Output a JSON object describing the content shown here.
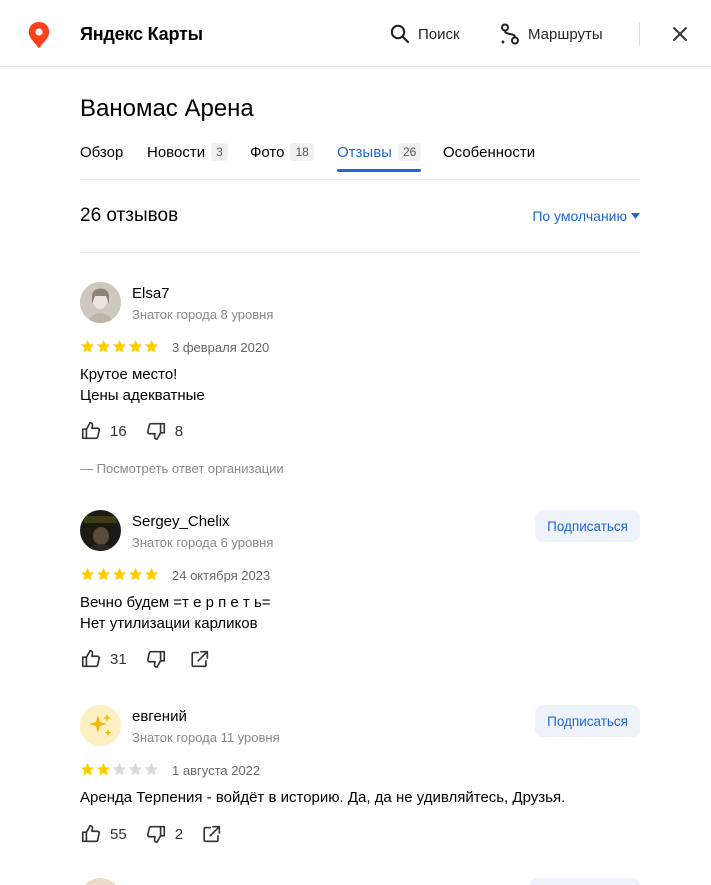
{
  "header": {
    "app_title": "Яндекс Карты",
    "search_label": "Поиск",
    "routes_label": "Маршруты",
    "brand_color": "#fc3f1d"
  },
  "place": {
    "title": "Ваномас Арена"
  },
  "tabs": [
    {
      "label": "Обзор",
      "count": ""
    },
    {
      "label": "Новости",
      "count": "3"
    },
    {
      "label": "Фото",
      "count": "18"
    },
    {
      "label": "Отзывы",
      "count": "26",
      "active": true
    },
    {
      "label": "Особенности",
      "count": ""
    }
  ],
  "reviews_header": {
    "count_label": "26 отзывов",
    "sort_label": "По умолчанию"
  },
  "reviews": [
    {
      "author": "Elsa7",
      "level": "Знаток города 8 уровня",
      "rating": 5,
      "date": "3 февраля 2020",
      "text": "Крутое место!\nЦены адекватные",
      "likes": "16",
      "dislikes": "8",
      "org_answer_label": "— Посмотреть ответ организации"
    },
    {
      "author": "Sergey_Chelix",
      "level": "Знаток города 6 уровня",
      "subscribe_label": "Подписаться",
      "rating": 5,
      "date": "24 октября 2023",
      "text": "Вечно будем =т е р п е т ь=\nНет утилизации карликов",
      "likes": "31",
      "dislikes": ""
    },
    {
      "author": "евгений",
      "level": "Знаток города 11 уровня",
      "subscribe_label": "Подписаться",
      "rating": 2,
      "date": "1 августа 2022",
      "text": "Аренда Терпения - войдёт в историю. Да, да не удивляйтесь, Друзья.",
      "likes": "55",
      "dislikes": "2"
    }
  ],
  "colors": {
    "accent": "#1f66d9",
    "star_filled": "#fc0",
    "star_empty": "#d9d9d9"
  }
}
